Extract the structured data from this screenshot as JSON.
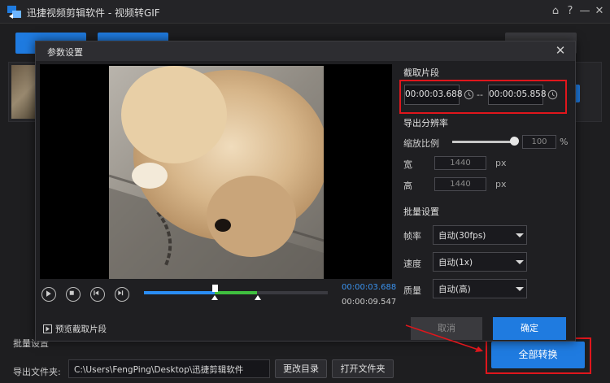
{
  "app": {
    "title": "迅捷视频剪辑软件 - 视频转GIF"
  },
  "window_controls": {
    "home": "⌂",
    "help": "?",
    "minimize": "—",
    "close": "✕"
  },
  "dialog": {
    "title": "参数设置",
    "close": "✕"
  },
  "clip": {
    "section_title": "截取片段",
    "start_time": "00:00:03.688",
    "separator": "--",
    "end_time": "00:00:05.858"
  },
  "resolution": {
    "section_title": "导出分辨率",
    "scale_label": "缩放比例",
    "scale_value": "100",
    "scale_unit": "%",
    "scale_fraction": 1.0,
    "width_label": "宽",
    "width_value": "1440",
    "height_label": "高",
    "height_value": "1440",
    "unit": "px"
  },
  "batch": {
    "section_title": "批量设置",
    "fps_label": "帧率",
    "fps_value": "自动(30fps)",
    "speed_label": "速度",
    "speed_value": "自动(1x)",
    "quality_label": "质量",
    "quality_value": "自动(高)"
  },
  "player": {
    "current_time": "00:00:03.688",
    "total_time": "00:00:09.547",
    "preview_clip_label": "预览截取片段"
  },
  "buttons": {
    "cancel": "取消",
    "ok": "确定",
    "change_dir": "更改目录",
    "open_folder": "打开文件夹",
    "convert_all": "全部转换"
  },
  "footer": {
    "batch_label": "批量设置",
    "output_label": "导出文件夹:",
    "output_path": "C:\\Users\\FengPing\\Desktop\\迅捷剪辑软件"
  },
  "colors": {
    "accent": "#1f7be0",
    "highlight": "#e0161c",
    "timeline_green": "#3fbf3f"
  }
}
